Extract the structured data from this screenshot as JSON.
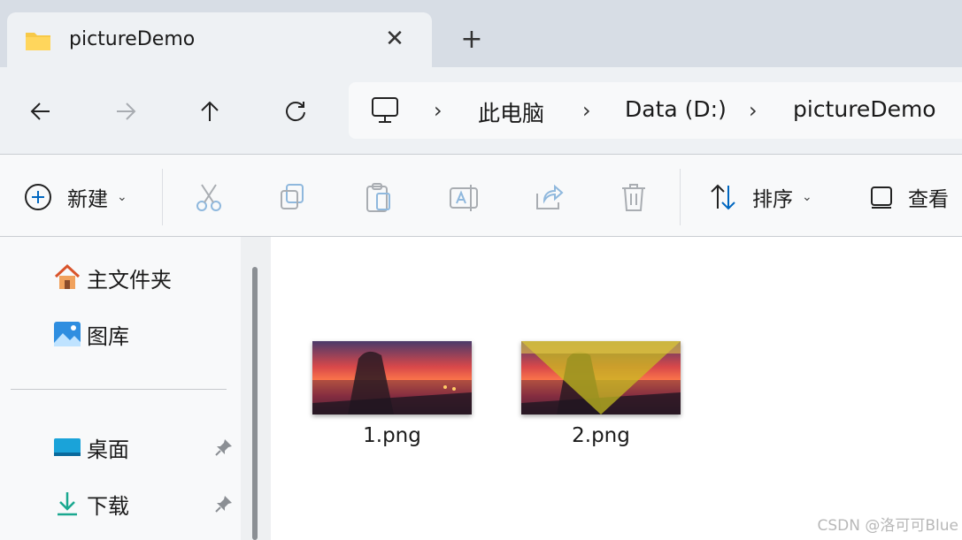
{
  "tab": {
    "title": "pictureDemo",
    "close_glyph": "✕",
    "new_tab_glyph": "+"
  },
  "nav": {
    "back_icon": "arrow-left-icon",
    "forward_icon": "arrow-right-icon",
    "up_icon": "arrow-up-icon",
    "refresh_icon": "refresh-icon"
  },
  "address": {
    "separator": "›",
    "crumbs": [
      "此电脑",
      "Data (D:)",
      "pictureDemo"
    ]
  },
  "commands": {
    "new_label": "新建",
    "sort_label": "排序",
    "view_label": "查看",
    "chevron": "⌄"
  },
  "sidebar": {
    "items": [
      {
        "label": "主文件夹",
        "icon": "home-icon"
      },
      {
        "label": "图库",
        "icon": "gallery-icon"
      },
      {
        "label": "桌面",
        "icon": "desktop-icon",
        "pinned": true
      },
      {
        "label": "下载",
        "icon": "download-icon",
        "pinned": true
      }
    ]
  },
  "files": [
    {
      "name": "1.png"
    },
    {
      "name": "2.png"
    }
  ],
  "watermark": "CSDN @洛可可Blue",
  "colors": {
    "accent": "#0067c0",
    "folder": "#f7c948",
    "tabstrip": "#d7dde5"
  }
}
